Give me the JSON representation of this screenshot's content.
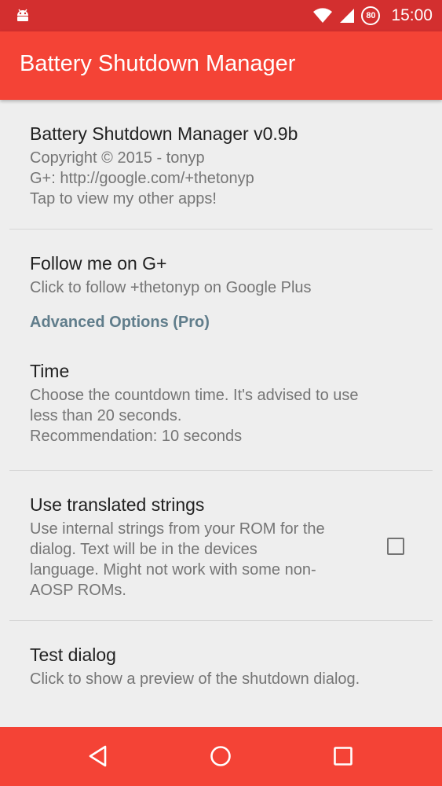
{
  "status_bar": {
    "time": "15:00",
    "battery_level": "80",
    "icons": [
      "android-debug-icon",
      "wifi-icon",
      "cellular-signal-icon",
      "battery-charging-icon"
    ]
  },
  "app_bar": {
    "title": "Battery Shutdown Manager"
  },
  "preferences": {
    "about": {
      "title": "Battery Shutdown Manager v0.9b",
      "line1": "Copyright © 2015 - tonyp",
      "line2": "G+: http://google.com/+thetonyp",
      "line3": "Tap to view my other apps!"
    },
    "follow": {
      "title": "Follow me on G+",
      "summary": "Click to follow +thetonyp on Google Plus"
    },
    "advanced_category": "Advanced Options (Pro)",
    "time": {
      "title": "Time",
      "line1": "Choose the countdown time. It's advised to use",
      "line2": "less than 20 seconds.",
      "line3": "Recommendation: 10 seconds"
    },
    "translated": {
      "title": "Use translated strings",
      "line1": "Use internal strings from your ROM for the",
      "line2": "dialog. Text will be in the devices",
      "line3": "language. Might not work with some non-",
      "line4": "AOSP ROMs.",
      "checked": false
    },
    "test_dialog": {
      "title": "Test dialog",
      "summary": "Click to show a preview of the shutdown dialog."
    }
  },
  "nav_bar": {
    "buttons": [
      "back-icon",
      "home-icon",
      "recents-icon"
    ]
  },
  "colors": {
    "status_bar": "#d32f2f",
    "app_bar": "#f44336",
    "nav_bar": "#f44336",
    "background": "#eeeeee",
    "category_text": "#607d8b"
  }
}
